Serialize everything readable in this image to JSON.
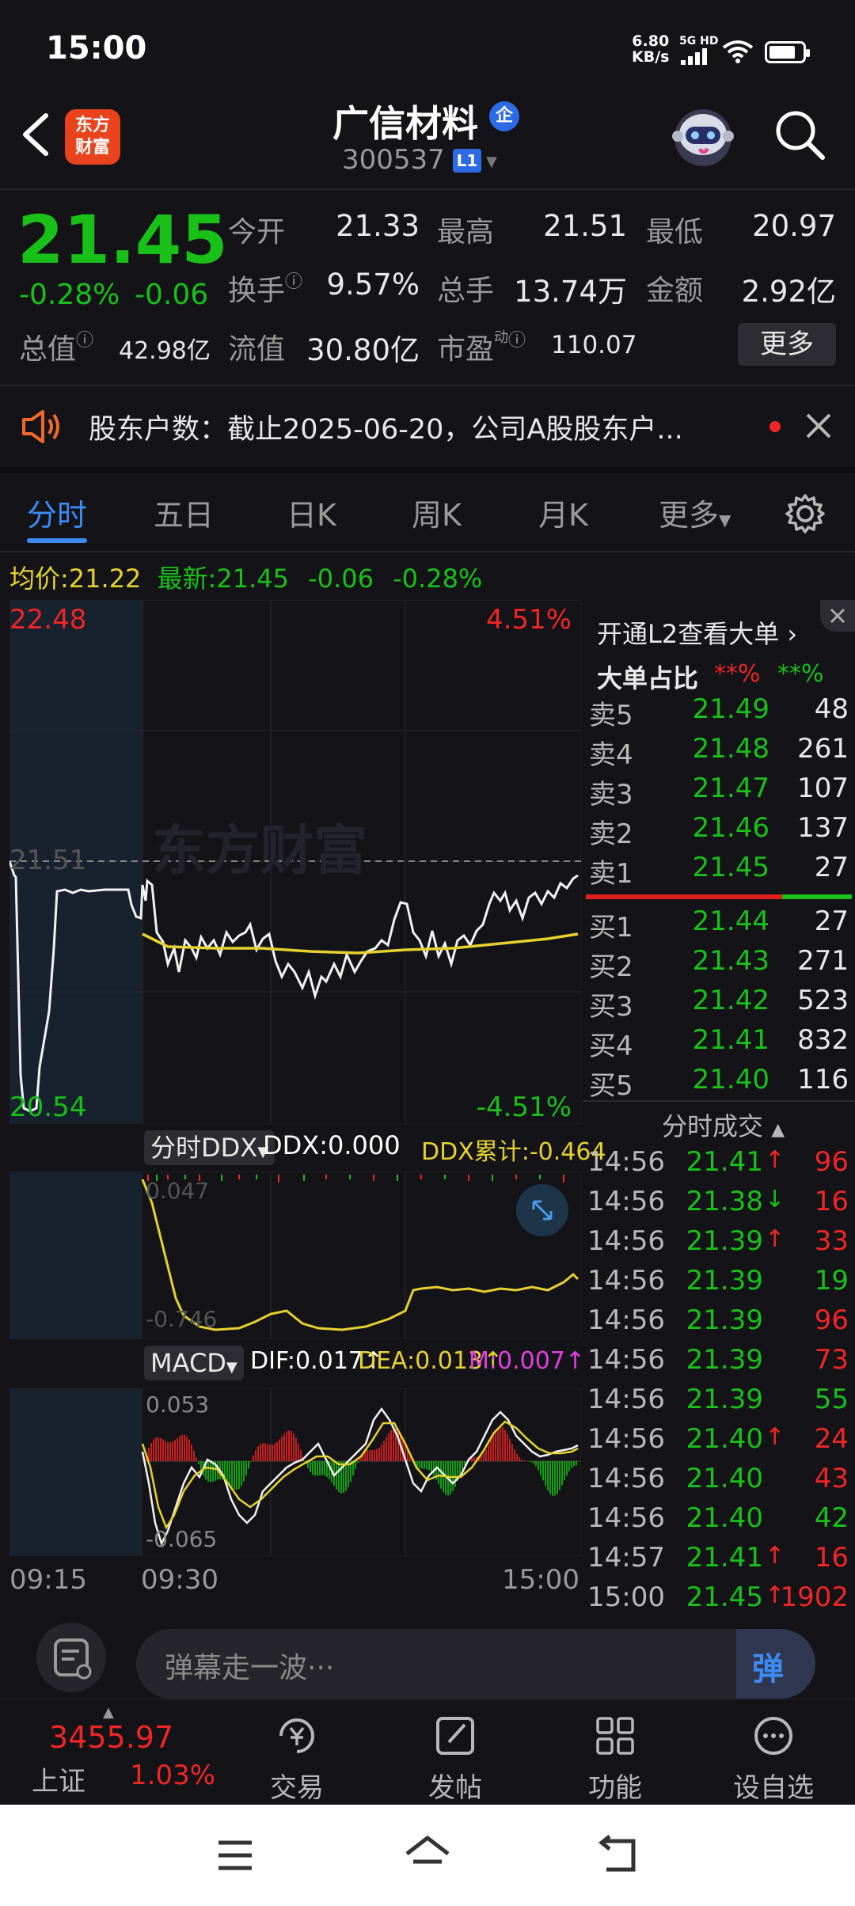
{
  "status": {
    "time": "15:00",
    "net_speed": "6.80",
    "net_unit": "KB/s",
    "signal": "5G HD"
  },
  "header": {
    "logo": "东方财富",
    "title": "广信材料",
    "badge": "企",
    "code": "300537",
    "level": "L1"
  },
  "quote": {
    "price": "21.45",
    "change_pct": "-0.28%",
    "change": "-0.06",
    "open_label": "今开",
    "open": "21.33",
    "high_label": "最高",
    "high": "21.51",
    "low_label": "最低",
    "low": "20.97",
    "turnover_label": "换手",
    "turnover": "9.57%",
    "volume_label": "总手",
    "volume": "13.74万",
    "amount_label": "金额",
    "amount": "2.92亿",
    "mktcap_label": "总值",
    "mktcap": "42.98亿",
    "float_label": "流值",
    "float": "30.80亿",
    "pe_label": "市盈",
    "pe_sup": "动",
    "pe": "110.07",
    "more": "更多"
  },
  "notice": {
    "text": "股东户数：截止2025-06-20，公司A股股东户..."
  },
  "tabs": [
    "分时",
    "五日",
    "日K",
    "周K",
    "月K",
    "更多"
  ],
  "avg": {
    "label": "均价:",
    "value": "21.22",
    "latest_label": "最新:",
    "latest": "21.45",
    "chg": "-0.06",
    "pct": "-0.28%"
  },
  "chart": {
    "y_top": "22.48",
    "y_bottom": "20.54",
    "pct_top": "4.51%",
    "pct_bottom": "-4.51%",
    "ref_line": "21.51",
    "watermark": "东方财富",
    "x_labels": [
      "09:15",
      "09:30",
      "15:00"
    ]
  },
  "ddx": {
    "selector": "分时DDX",
    "ddx": "DDX:0.000",
    "cum": "DDX累计:-0.464",
    "top": "0.047",
    "bottom": "-0.746"
  },
  "macd": {
    "selector": "MACD",
    "dif": "DIF:0.017",
    "dea": "DEA:0.013",
    "m": "M:0.007",
    "top": "0.053",
    "bottom": "-0.065"
  },
  "l2": {
    "promo": "开通L2查看大单",
    "big_ratio": "大单占比",
    "ratio_sell": "**%",
    "ratio_buy": "**%"
  },
  "asks": [
    {
      "label": "卖5",
      "price": "21.49",
      "vol": "48"
    },
    {
      "label": "卖4",
      "price": "21.48",
      "vol": "261"
    },
    {
      "label": "卖3",
      "price": "21.47",
      "vol": "107"
    },
    {
      "label": "卖2",
      "price": "21.46",
      "vol": "137"
    },
    {
      "label": "卖1",
      "price": "21.45",
      "vol": "27"
    }
  ],
  "bids": [
    {
      "label": "买1",
      "price": "21.44",
      "vol": "27"
    },
    {
      "label": "买2",
      "price": "21.43",
      "vol": "271"
    },
    {
      "label": "买3",
      "price": "21.42",
      "vol": "523"
    },
    {
      "label": "买4",
      "price": "21.41",
      "vol": "832"
    },
    {
      "label": "买5",
      "price": "21.40",
      "vol": "116"
    }
  ],
  "trades_title": "分时成交",
  "trades": [
    {
      "t": "14:56",
      "p": "21.41",
      "dir": "↑",
      "v": "96",
      "vc": "red"
    },
    {
      "t": "14:56",
      "p": "21.38",
      "dir": "↓",
      "v": "16",
      "vc": "red"
    },
    {
      "t": "14:56",
      "p": "21.39",
      "dir": "↑",
      "v": "33",
      "vc": "red"
    },
    {
      "t": "14:56",
      "p": "21.39",
      "dir": "",
      "v": "19",
      "vc": "green"
    },
    {
      "t": "14:56",
      "p": "21.39",
      "dir": "",
      "v": "96",
      "vc": "red"
    },
    {
      "t": "14:56",
      "p": "21.39",
      "dir": "",
      "v": "73",
      "vc": "red"
    },
    {
      "t": "14:56",
      "p": "21.39",
      "dir": "",
      "v": "55",
      "vc": "green"
    },
    {
      "t": "14:56",
      "p": "21.40",
      "dir": "↑",
      "v": "24",
      "vc": "red"
    },
    {
      "t": "14:56",
      "p": "21.40",
      "dir": "",
      "v": "43",
      "vc": "red"
    },
    {
      "t": "14:56",
      "p": "21.40",
      "dir": "",
      "v": "42",
      "vc": "green"
    },
    {
      "t": "14:57",
      "p": "21.41",
      "dir": "↑",
      "v": "16",
      "vc": "red"
    },
    {
      "t": "15:00",
      "p": "21.45",
      "dir": "↑",
      "v": "1902",
      "vc": "red"
    }
  ],
  "input": {
    "placeholder": "弹幕走一波···",
    "dan": "弹"
  },
  "index": {
    "value": "3455.97",
    "name": "上证",
    "pct": "1.03%"
  },
  "toolbar": [
    "交易",
    "发帖",
    "功能",
    "设自选"
  ],
  "colors": {
    "up": "#f02626",
    "down": "#18c018",
    "accent": "#3d8bf2",
    "avg_line": "#e6d22e"
  }
}
